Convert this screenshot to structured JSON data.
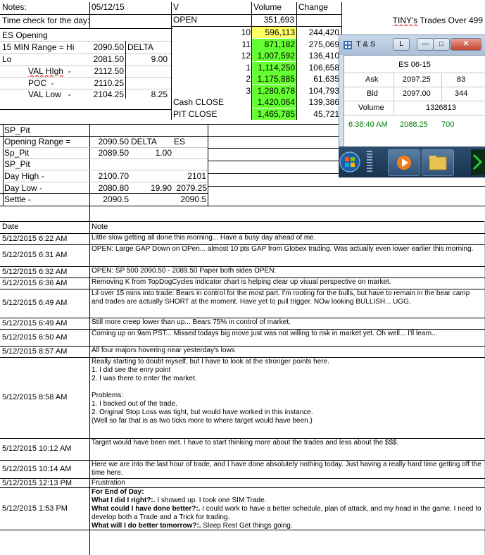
{
  "header": {
    "notes_label": "Notes:",
    "date": "05/12/15",
    "v_label": "V",
    "volume_label": "Volume",
    "change_label": "Change",
    "time_check_label": "Time check for the day:",
    "open_label": "OPEN",
    "open_volume": "351,693",
    "title": "TINY's Trades Over 499"
  },
  "es_block": {
    "title": "ES Opening",
    "range_label": "15 MIN Range = Hi",
    "range_hi": "2090.50",
    "delta_label": "DELTA",
    "lo_label": "Lo",
    "lo_value": "2081.50",
    "delta_value": "9.00",
    "val_high_label": "VAL HIgh",
    "val_high": "2112.50",
    "poc_label": "POC",
    "poc": "2110.25",
    "val_low_label": "VAL Low",
    "val_low": "2104.25",
    "val_low_delta": "8.25"
  },
  "volume_rows": [
    {
      "hour": "10",
      "volume": "596,113",
      "change": "244,420",
      "color": "#ffff66"
    },
    {
      "hour": "11",
      "volume": "871,182",
      "change": "275,069",
      "color": "#66ff33"
    },
    {
      "hour": "12",
      "volume": "1,007,592",
      "change": "136,410",
      "color": "#66ff33"
    },
    {
      "hour": "1",
      "volume": "1,114,250",
      "change": "106,658",
      "color": "#66ff33"
    },
    {
      "hour": "2",
      "volume": "1,175,885",
      "change": "61,635",
      "color": "#66ff33"
    },
    {
      "hour": "3",
      "volume": "1,280,678",
      "change": "104,793",
      "color": "#66ff33"
    },
    {
      "label": "Cash CLOSE",
      "volume": "1,420,064",
      "change": "139,386",
      "color": "#66ff33"
    },
    {
      "label": "PIT CLOSE",
      "volume": "1,465,785",
      "change": "45,721",
      "color": "#66ff33"
    }
  ],
  "sp_pit": {
    "title": "SP_Pit",
    "range_label": "Opening Range =",
    "range_value": "2090.50",
    "delta_label": "DELTA",
    "es_label": "ES",
    "sp_pit_label": "Sp_Pit",
    "sp_pit_value": "2089.50",
    "sp_pit_delta": "1.00",
    "title2": "SP_Pit",
    "day_high_label": "Day High -",
    "day_high": "2100.70",
    "day_high_es": "2101",
    "day_low_label": "Day Low -",
    "day_low": "2080.80",
    "day_low_delta": "19.90",
    "day_low_es": "2079.25",
    "settle_label": "Settle -",
    "settle": "2090.5",
    "settle_es": "2090.5"
  },
  "ts_window": {
    "title": "T & S",
    "l_button": "L",
    "symbol": "ES 06-15",
    "ask_label": "Ask",
    "ask_price": "2097.25",
    "ask_size": "83",
    "bid_label": "Bid",
    "bid_price": "2097.00",
    "bid_size": "344",
    "volume_label": "Volume",
    "volume": "1326813",
    "trade_time": "6:38:40 AM",
    "trade_price": "2088.25",
    "trade_size": "700",
    "text_color": "#008000"
  },
  "log": {
    "date_header": "Date",
    "note_header": "Note",
    "entries": [
      {
        "date": "5/12/2015 6:22 AM",
        "note": "Little slow getting all done this morning... Have a busy day ahead of me."
      },
      {
        "date": "5/12/2015 6:31 AM",
        "note": "OPEN: Large GAP Down on OPen... almost 10 pts GAP from Globex trading.   Was actually even lower earlier this morning."
      },
      {
        "date": "5/12/2015 6:32 AM",
        "note": "OPEN: SP 500 2090.50 - 2089.50 Paper both sides OPEN:"
      },
      {
        "date": "5/12/2015 6:36 AM",
        "note": "Removing K from TopDogCycles indicator chart is helping clear up visual perspective on market."
      },
      {
        "date": "5/12/2015 6:49 AM",
        "note": "Lil over 15 mins into trade: Bears in control for the most part.  I'm rooting for the bulls, but have to remain in the bear camp and trades are actually SHORT at the moment.  Have yet to pull trigger.  NOw looking BULLISH... UGG."
      },
      {
        "date": "5/12/2015 6:49 AM",
        "note": "Still more creep lower than up... Bears 75% in control of market."
      },
      {
        "date": "5/12/2015 6:50 AM",
        "note": "Coming up on 9am PST... Missed todays big move just was not willing to risk in market yet.  Oh well... I'll learn..."
      },
      {
        "date": "5/12/2015 8:57 AM",
        "note": "All four majors hovering near yesterday's lows"
      },
      {
        "date": "5/12/2015 8:58 AM",
        "lines": [
          "Really starting to doubt myself, but I have to look at the stronger points here.",
          "1. I did see the enry point",
          "2. I was there to enter the market.",
          "",
          "Problems:",
          "1. I backed out of the trade.",
          "2. Original Stop Loss was tight, but would have worked in this instance.",
          "(Well so far that is as two ticks more to where target would have been.)"
        ]
      },
      {
        "date": "5/12/2015 10:12 AM",
        "note": "Target would have been met.  I have to start thinking more about the trades and less about the $$$."
      },
      {
        "date": "5/12/2015 10:14 AM",
        "note": "Here we are into the last hour of trade, and I have done absolutely nothing today.   Just having a really hard time getting off the time here."
      },
      {
        "date": "5/12/2015 12:13 PM",
        "note": "Frustration"
      },
      {
        "date": "5/12/2015 1:53 PM",
        "eod_title": "For End of Day:",
        "eod_lines": [
          {
            "q": "What I did I right?:.",
            "a": " I showed up.  I took one SIM Trade."
          },
          {
            "q": "What could I have done better?:.",
            "a": " I could work to have a better schedule, plan of attack, and my head in the game.  I need to develop both a Trade and a Trick for trading."
          },
          {
            "q": "What will I do better tomorrow?:.",
            "a": " Sleep Rest Get things going."
          }
        ]
      }
    ]
  }
}
